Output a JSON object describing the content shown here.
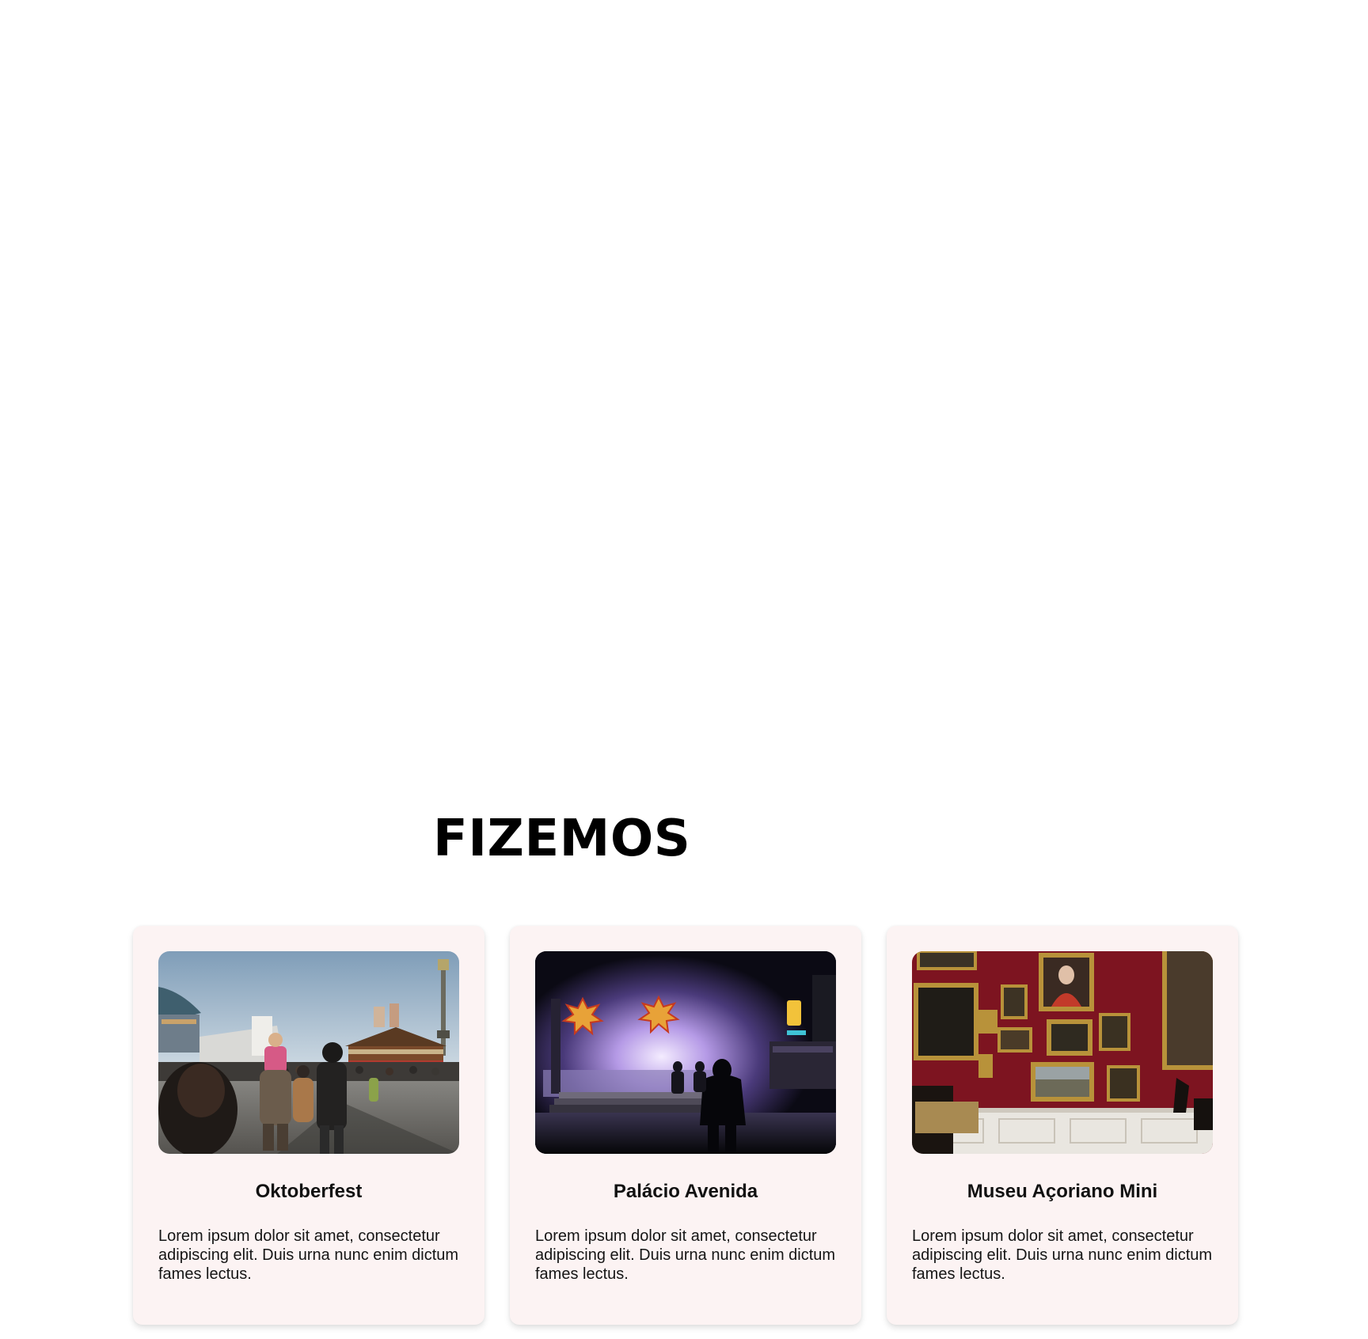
{
  "section": {
    "title": "FIZEMOS"
  },
  "cards": [
    {
      "title": "Oktoberfest",
      "text": "Lorem ipsum dolor sit amet, consectetur adipiscing elit. Duis urna nunc enim dictum fames lectus.",
      "image": "oktoberfest-fairground-photo"
    },
    {
      "title": "Palácio Avenida",
      "text": "Lorem ipsum dolor sit amet, consectetur adipiscing elit. Duis urna nunc enim dictum fames lectus.",
      "image": "night-carnival-ride-photo"
    },
    {
      "title": "Museu Açoriano Mini",
      "text": "Lorem ipsum dolor sit amet, consectetur adipiscing elit. Duis urna nunc enim dictum fames lectus.",
      "image": "museum-gallery-paintings-photo"
    }
  ],
  "colors": {
    "card_background": "#fcf3f3",
    "title_text": "#000000",
    "museum_wall": "#7d1420"
  }
}
